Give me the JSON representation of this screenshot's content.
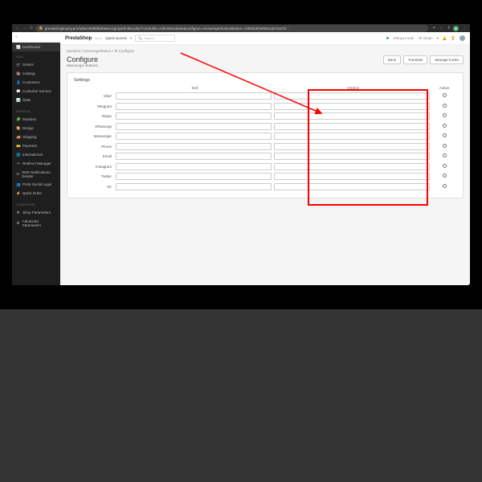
{
  "browser": {
    "url": "prestashop8.pixy.pro/admin6088f8dn66ec3gnlyer/index.php?controller=AdminModules&configure=messengerbutton&token=7d69d25f466941da7a0cf4...",
    "badge": "N"
  },
  "logo": "PrestaShop",
  "version": "8.0.1",
  "quick_access": "Quick access",
  "search_placeholder": "Search",
  "topbar": {
    "debug": "Debug mode",
    "shops": "All shops"
  },
  "sidebar": {
    "dashboard": "Dashboard",
    "sell_label": "SELL",
    "sell": [
      {
        "icon": "🛒",
        "label": "Orders"
      },
      {
        "icon": "📚",
        "label": "Catalog"
      },
      {
        "icon": "👤",
        "label": "Customers"
      },
      {
        "icon": "💬",
        "label": "Customer Service"
      },
      {
        "icon": "📊",
        "label": "Stats"
      }
    ],
    "improve_label": "IMPROVE",
    "improve": [
      {
        "icon": "🧩",
        "label": "Modules"
      },
      {
        "icon": "🎨",
        "label": "Design"
      },
      {
        "icon": "🚚",
        "label": "Shipping"
      },
      {
        "icon": "💳",
        "label": "Payment"
      },
      {
        "icon": "🌐",
        "label": "International"
      },
      {
        "icon": "↪",
        "label": "Redirect Manager"
      },
      {
        "icon": "✉",
        "label": "SMS Notifications Sender"
      },
      {
        "icon": "👥",
        "label": "Prnla Social Login"
      },
      {
        "icon": "⚡",
        "label": "Quick Order"
      }
    ],
    "configure_label": "CONFIGURE",
    "configure": [
      {
        "icon": "⚙",
        "label": "Shop Parameters"
      },
      {
        "icon": "⚙",
        "label": "Advanced Parameters"
      }
    ]
  },
  "breadcrumb": "Modules / messengerbutton / ⚙ Configure",
  "page": {
    "title": "Configure",
    "subtitle": "Messenger Buttons"
  },
  "buttons": {
    "back": "Back",
    "translate": "Translate",
    "hooks": "Manage hooks"
  },
  "panel": {
    "title": "Settings",
    "col_href": "href",
    "col_onclick": "Onclick",
    "col_active": "Active",
    "rows": [
      "Viber",
      "Telegram",
      "Skype",
      "WhatsApp",
      "Messenger",
      "Phone",
      "Email",
      "Instagram",
      "Twitter",
      "VK"
    ]
  }
}
